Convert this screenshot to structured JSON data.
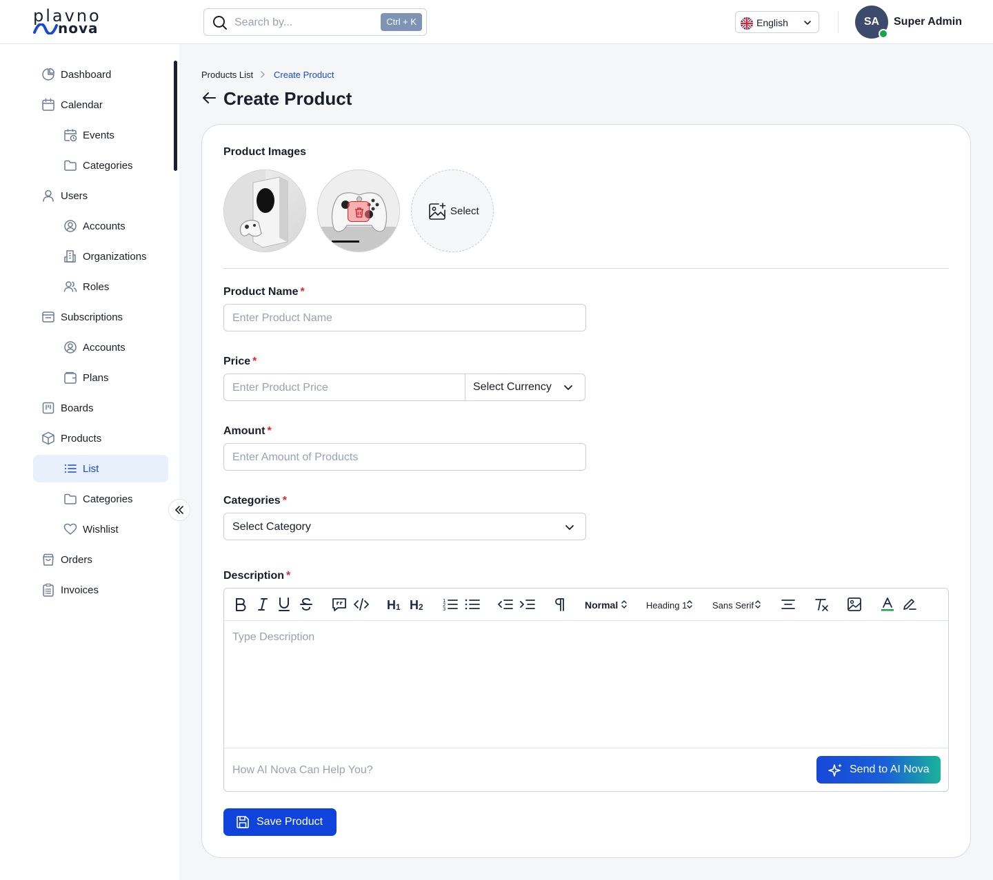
{
  "brand": {
    "top": "plavno",
    "bottom": "nova"
  },
  "header": {
    "search_placeholder": "Search by...",
    "search_shortcut": "Ctrl + K",
    "language": "English",
    "avatar_initials": "SA",
    "user_name": "Super Admin"
  },
  "sidebar": {
    "items": [
      {
        "label": "Dashboard",
        "icon": "pie-chart-icon"
      },
      {
        "label": "Calendar",
        "icon": "calendar-icon",
        "expanded": true
      },
      {
        "label": "Events",
        "icon": "calendar-clock-icon"
      },
      {
        "label": "Categories",
        "icon": "folder-icon"
      },
      {
        "label": "Users",
        "icon": "user-icon",
        "expanded": true
      },
      {
        "label": "Accounts",
        "icon": "user-circle-icon"
      },
      {
        "label": "Organizations",
        "icon": "building-icon"
      },
      {
        "label": "Roles",
        "icon": "users-icon"
      },
      {
        "label": "Subscriptions",
        "icon": "inbox-icon",
        "expanded": true
      },
      {
        "label": "Accounts",
        "icon": "user-circle-icon"
      },
      {
        "label": "Plans",
        "icon": "wallet-icon"
      },
      {
        "label": "Boards",
        "icon": "board-icon",
        "expanded": false
      },
      {
        "label": "Products",
        "icon": "box-icon",
        "expanded": true
      },
      {
        "label": "List",
        "icon": "list-icon",
        "active": true
      },
      {
        "label": "Categories",
        "icon": "folder-icon"
      },
      {
        "label": "Wishlist",
        "icon": "heart-icon"
      },
      {
        "label": "Orders",
        "icon": "shopping-bag-icon"
      },
      {
        "label": "Invoices",
        "icon": "clipboard-icon"
      }
    ]
  },
  "breadcrumb": {
    "parent": "Products List",
    "current": "Create Product"
  },
  "page_title": "Create Product",
  "form": {
    "images_label": "Product Images",
    "select_image_label": "Select",
    "product_name": {
      "label": "Product Name",
      "placeholder": "Enter Product Name",
      "required_mark": "*"
    },
    "price": {
      "label": "Price",
      "placeholder": "Enter Product Price",
      "currency": "Select Currency",
      "required_mark": "*"
    },
    "amount": {
      "label": "Amount",
      "placeholder": "Enter Amount of Products",
      "required_mark": "*"
    },
    "categories": {
      "label": "Categories",
      "value": "Select Category",
      "required_mark": "*"
    },
    "description": {
      "label": "Description",
      "required_mark": "*",
      "placeholder": "Type Description",
      "toolbar": {
        "normal": "Normal",
        "heading": "Heading 1",
        "font": "Sans Serif",
        "h1": "H",
        "h2": "H"
      },
      "ai_placeholder": "How AI Nova Can Help You?",
      "ai_button": "Send to AI Nova"
    },
    "save_button": "Save Product"
  },
  "colors": {
    "accent": "#1043dc",
    "active_bg": "#e8f0fb",
    "required": "#e0242c",
    "online": "#1aa34a"
  }
}
